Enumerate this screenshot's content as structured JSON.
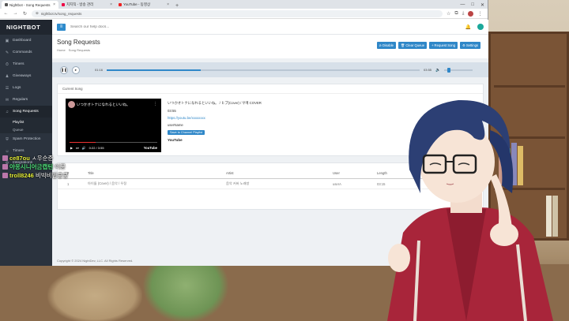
{
  "browser": {
    "tabs": [
      {
        "label": "Nightbot - Song Requests",
        "active": true
      },
      {
        "label": "치지직 - 방송 관리",
        "active": false
      },
      {
        "label": "YouTube - 동영상",
        "active": false
      }
    ],
    "url": "nightbot.tv/song_requests"
  },
  "app": {
    "brand": "NIGHTBOT",
    "search_placeholder": "Search our help docs..."
  },
  "sidebar": {
    "items": [
      {
        "icon": "▣",
        "label": "Dashboard"
      },
      {
        "icon": "✎",
        "label": "Commands"
      },
      {
        "icon": "⏱",
        "label": "Timers"
      },
      {
        "icon": "♟",
        "label": "Giveaways"
      },
      {
        "icon": "☰",
        "label": "Logs"
      },
      {
        "icon": "✉",
        "label": "Regulars"
      },
      {
        "icon": "♫",
        "label": "Song Requests"
      },
      {
        "icon": "⛨",
        "label": "Spam Protection"
      },
      {
        "icon": "☺",
        "label": "Timers"
      },
      {
        "icon": "⚙",
        "label": "Integrations"
      }
    ],
    "sub_items": [
      {
        "label": "Playlist"
      },
      {
        "label": "Queue"
      }
    ]
  },
  "page": {
    "title": "Song Requests",
    "breadcrumb": [
      "Home",
      "Song Requests"
    ],
    "buttons": [
      {
        "icon": "⊘",
        "label": "Disable"
      },
      {
        "icon": "🗑",
        "label": "Clear Queue"
      },
      {
        "icon": "+",
        "label": "Request Song"
      },
      {
        "icon": "⚙",
        "label": "Settings"
      }
    ]
  },
  "player": {
    "current_time": "01:16",
    "total_time": "03:55",
    "progress": 0.3,
    "volume": 0.1
  },
  "current_song": {
    "heading": "Current Song",
    "video_title": "いつかオトナになれるといいね。",
    "title": "いつかオトナになれるといいね。 / ヒプ(Cover) / 우메 COVER",
    "duration": "03:55",
    "link": "https://youtu.be/xxxxxxxx",
    "requester": "userName",
    "add_playlist_label": "Save to Channel Playlist",
    "video_time": "0:22 / 3:55",
    "brand": "YouTube"
  },
  "queue": {
    "columns": [
      "#",
      "Title",
      "Artist",
      "User",
      "Length"
    ],
    "rows": [
      [
        "1",
        "아이돌 (Cover) / 음악 / 우정",
        "음악 커버 노래방",
        "userA",
        "03:15"
      ]
    ]
  },
  "footer": "Copyright © 2024 NightDev, LLC. All Rights Reserved.",
  "chat": [
    {
      "name": "ce87ou",
      "name_color": "#e7f03a",
      "msg": "ㅅ우순준"
    },
    {
      "name": "야옹시니어금캡틴",
      "name_color": "#4fe07a",
      "msg": "이문"
    },
    {
      "name": "troll8246",
      "name_color": "#e7f03a",
      "msg": "비빅비빕쿵쿵"
    }
  ],
  "colors": {
    "accent": "#2f87c8",
    "sidebar": "#2b333e"
  }
}
